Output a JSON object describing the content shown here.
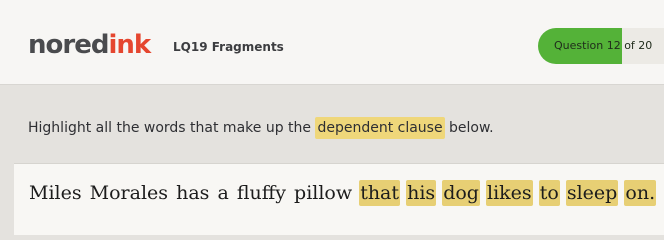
{
  "header": {
    "logo_main": "nored",
    "logo_accent": "ink",
    "quiz_title": "LQ19 Fragments",
    "progress_label": "Question 12 of 20",
    "progress": {
      "current": 12,
      "total": 20
    }
  },
  "prompt": {
    "before": "Highlight all the words that make up the ",
    "highlight": "dependent clause",
    "after": " below."
  },
  "sentence": {
    "words": [
      {
        "text": "Miles",
        "selected": false
      },
      {
        "text": "Morales",
        "selected": false
      },
      {
        "text": "has",
        "selected": false
      },
      {
        "text": "a",
        "selected": false
      },
      {
        "text": "fluffy",
        "selected": false
      },
      {
        "text": "pillow",
        "selected": false
      },
      {
        "text": "that",
        "selected": true
      },
      {
        "text": "his",
        "selected": true
      },
      {
        "text": "dog",
        "selected": true
      },
      {
        "text": "likes",
        "selected": true
      },
      {
        "text": "to",
        "selected": true
      },
      {
        "text": "sleep",
        "selected": true
      },
      {
        "text": "on.",
        "selected": true
      }
    ]
  },
  "colors": {
    "brand_red": "#e5462f",
    "progress_green": "#54b238",
    "highlight": "#e7cf74"
  }
}
